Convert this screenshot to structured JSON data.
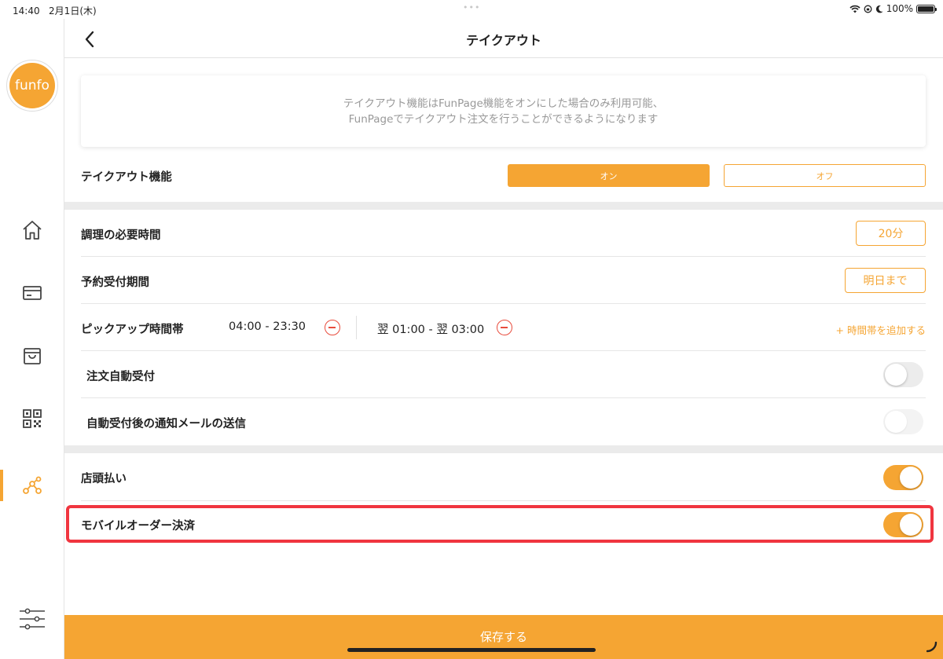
{
  "status_bar": {
    "time": "14:40",
    "date": "2月1日(木)",
    "battery": "100%",
    "dots": "•••"
  },
  "sidebar": {
    "logo_text": "funfo",
    "items": [
      {
        "name": "home",
        "icon": "home-icon",
        "active": false
      },
      {
        "name": "payment",
        "icon": "card-icon",
        "active": false
      },
      {
        "name": "shop",
        "icon": "bag-icon",
        "active": false
      },
      {
        "name": "qr",
        "icon": "qr-code-icon",
        "active": false
      },
      {
        "name": "share",
        "icon": "share-network-icon",
        "active": true
      }
    ],
    "settings_icon": "sliders-icon"
  },
  "header": {
    "title": "テイクアウト",
    "back_icon": "chevron-left-icon"
  },
  "notice": {
    "line1": "テイクアウト機能はFunPage機能をオンにした場合のみ利用可能、",
    "line2": "FunPageでテイクアウト注文を行うことができるようになります"
  },
  "takeout_feature": {
    "label": "テイクアウト機能",
    "on_label": "オン",
    "off_label": "オフ",
    "selected": "オン"
  },
  "cook_time": {
    "label": "調理の必要時間",
    "value": "20分"
  },
  "reservation_period": {
    "label": "予約受付期間",
    "value": "明日まで"
  },
  "pickup": {
    "label": "ピックアップ時間帯",
    "slots": [
      "04:00 -  23:30",
      "翌 01:00 - 翌 03:00"
    ],
    "add_label": "+ 時間帯を追加する"
  },
  "auto_accept": {
    "label": "注文自動受付",
    "enabled": false
  },
  "notify_email": {
    "label": "自動受付後の通知メールの送信",
    "enabled": false
  },
  "pay_at_store": {
    "label": "店頭払い",
    "enabled": true
  },
  "mobile_order_payment": {
    "label": "モバイルオーダー決済",
    "enabled": true
  },
  "save_button": {
    "label": "保存する"
  },
  "colors": {
    "accent": "#f5a533",
    "highlight": "#f0353f",
    "danger": "#e84c3d"
  }
}
